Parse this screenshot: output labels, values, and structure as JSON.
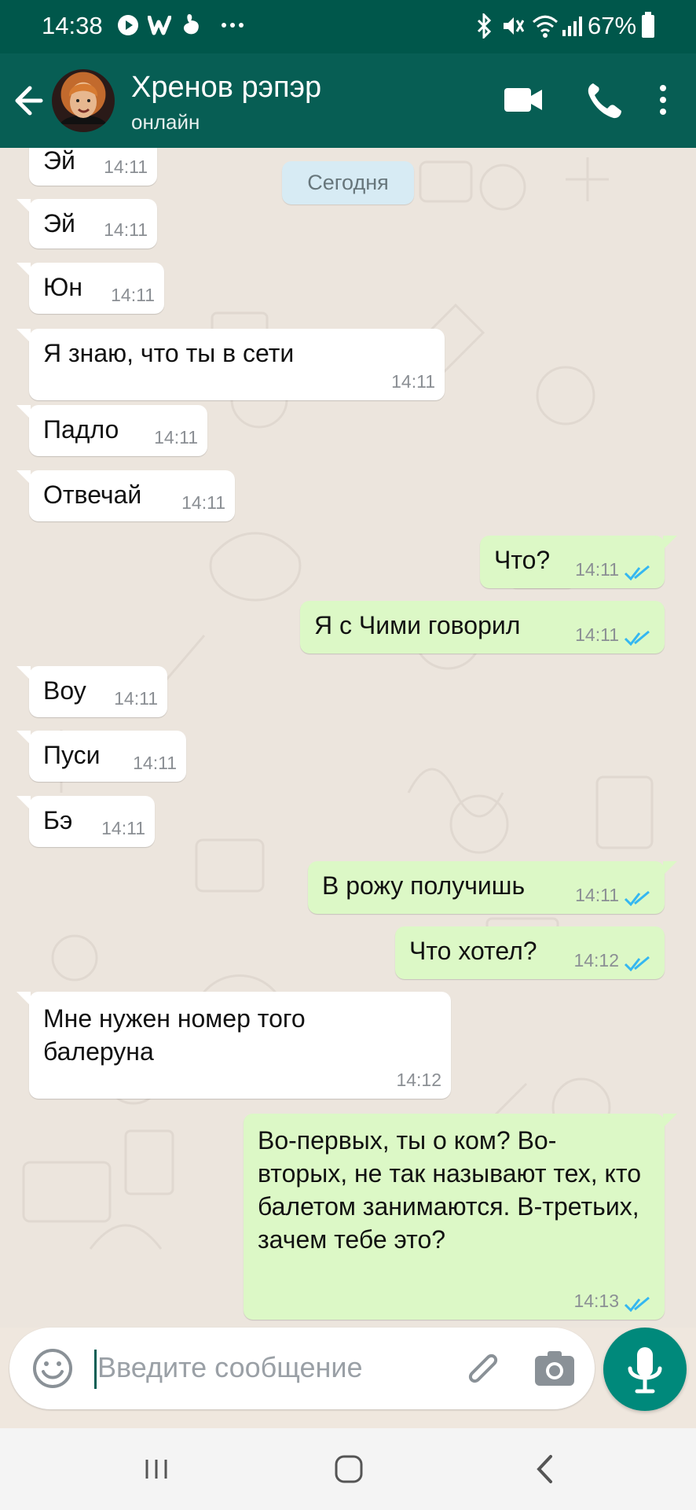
{
  "status_bar": {
    "time": "14:38",
    "battery": "67%",
    "icons": [
      "play-icon",
      "w-icon",
      "hand-icon",
      "more-icon",
      "bluetooth-icon",
      "mute-icon",
      "wifi-icon",
      "signal-icon",
      "battery-icon"
    ]
  },
  "header": {
    "name": "Хренов рэпэр",
    "status": "онлайн",
    "icons": [
      "back-arrow-icon",
      "avatar",
      "video-call-icon",
      "phone-call-icon",
      "menu-icon"
    ]
  },
  "chat": {
    "date_label": "Сегодня",
    "messages": [
      {
        "dir": "in",
        "text": "Эй",
        "time": "14:11"
      },
      {
        "dir": "in",
        "text": "Эй",
        "time": "14:11"
      },
      {
        "dir": "in",
        "text": "Юн",
        "time": "14:11"
      },
      {
        "dir": "in",
        "text": "Я знаю, что ты в сети",
        "time": "14:11"
      },
      {
        "dir": "in",
        "text": "Падло",
        "time": "14:11"
      },
      {
        "dir": "in",
        "text": "Отвечай",
        "time": "14:11"
      },
      {
        "dir": "out",
        "text": "Что?",
        "time": "14:11",
        "status": "read"
      },
      {
        "dir": "out",
        "text": "Я с Чими говорил",
        "time": "14:11",
        "status": "read"
      },
      {
        "dir": "in",
        "text": "Воу",
        "time": "14:11"
      },
      {
        "dir": "in",
        "text": "Пуси",
        "time": "14:11"
      },
      {
        "dir": "in",
        "text": "Бэ",
        "time": "14:11"
      },
      {
        "dir": "out",
        "text": "В рожу получишь",
        "time": "14:11",
        "status": "read"
      },
      {
        "dir": "out",
        "text": "Что хотел?",
        "time": "14:12",
        "status": "read"
      },
      {
        "dir": "in",
        "text": "Мне нужен номер того балеруна",
        "time": "14:12"
      },
      {
        "dir": "out",
        "text": "Во-первых, ты о ком? Во-вторых, не так называют тех, кто балетом занимаются. В-третьих, зачем тебе это?",
        "time": "14:13",
        "status": "read"
      }
    ]
  },
  "composer": {
    "placeholder": "Введите сообщение",
    "icons": [
      "emoji-icon",
      "attach-icon",
      "camera-icon",
      "microphone-icon"
    ]
  },
  "navigation": {
    "icons": [
      "recent-apps-icon",
      "home-icon",
      "back-icon"
    ]
  },
  "colors": {
    "header": "#075e54",
    "status_bar": "#00574b",
    "outgoing_bubble": "#dcf8c6",
    "incoming_bubble": "#ffffff",
    "read_ticks": "#34b7f1",
    "mic_button": "#00897b"
  }
}
